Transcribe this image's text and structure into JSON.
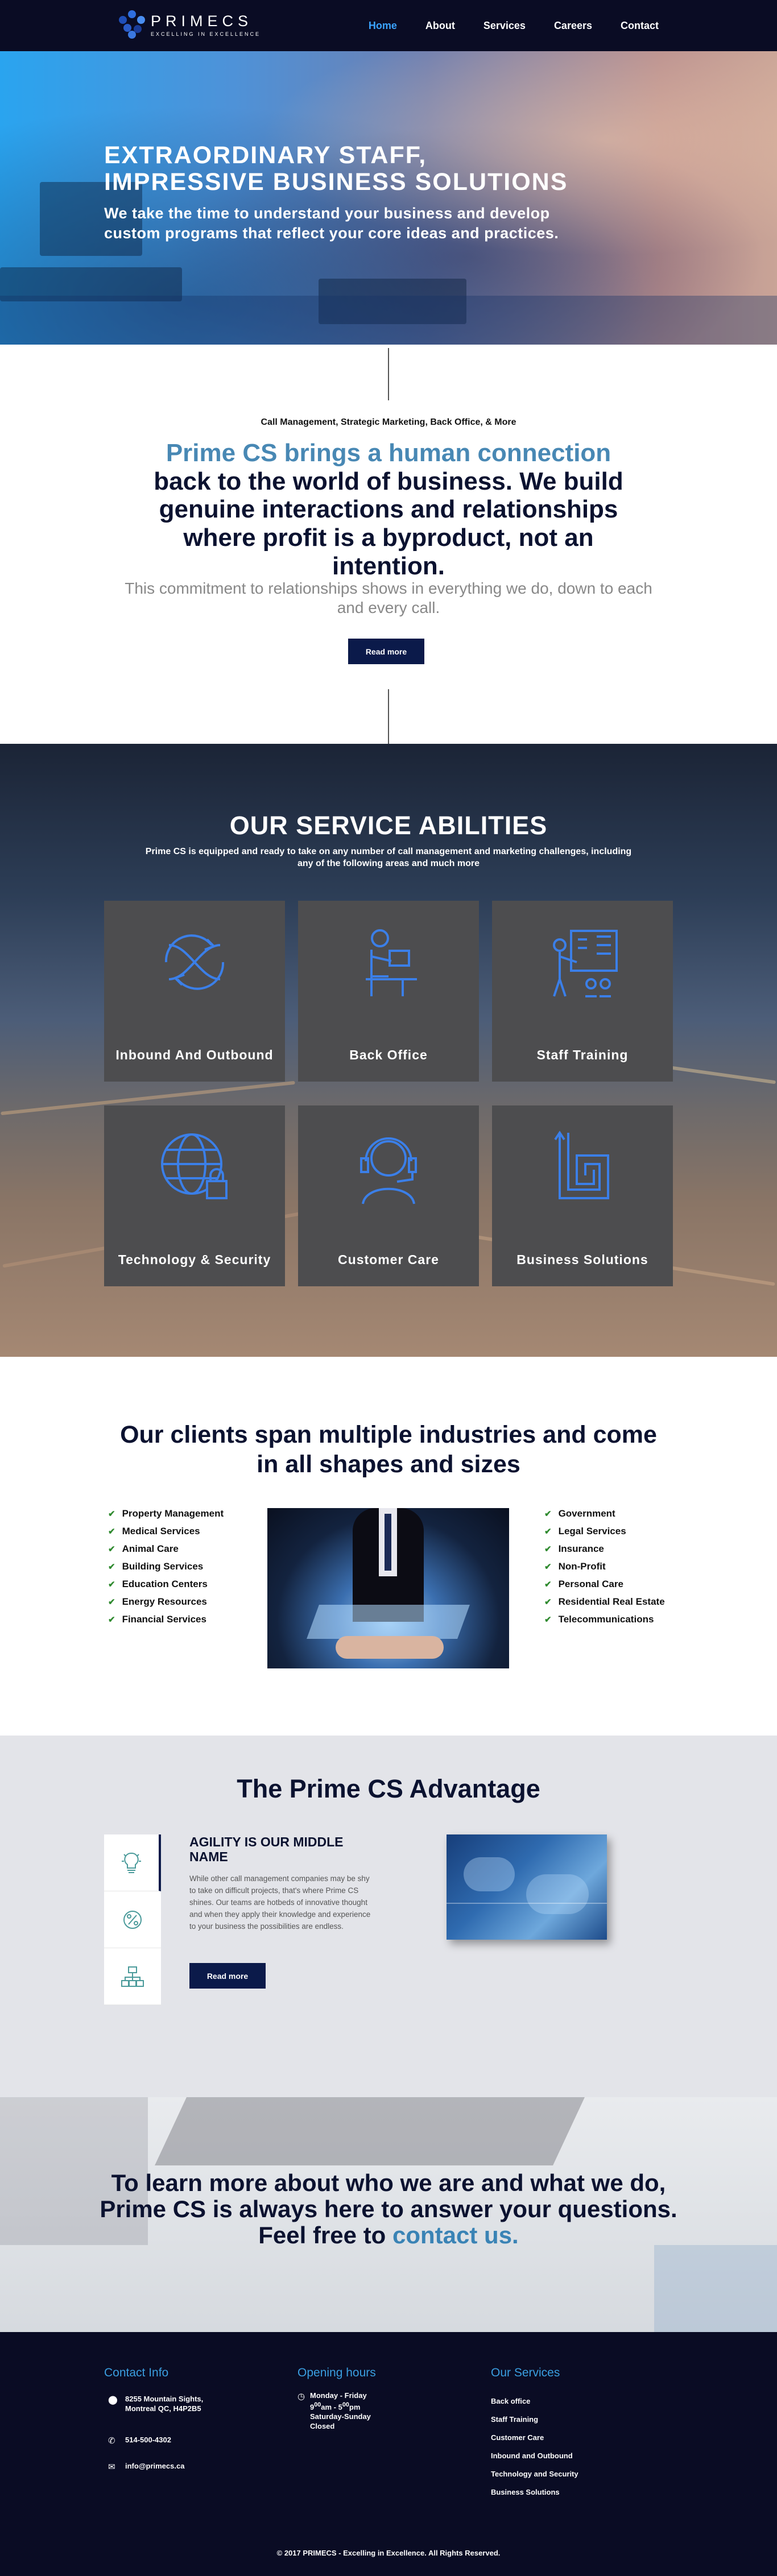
{
  "nav": {
    "logo_name": "PRIMECS",
    "logo_tagline": "EXCELLING IN EXCELLENCE",
    "links": [
      "Home",
      "About",
      "Services",
      "Careers",
      "Contact"
    ],
    "active": "Home",
    "active_color": "#3aa3ff"
  },
  "hero": {
    "title": "EXTRAORDINARY STAFF, IMPRESSIVE BUSINESS SOLUTIONS",
    "text": "We take the time to understand your business and develop custom programs that reflect your core ideas and practices."
  },
  "intro": {
    "subtitle": "Call Management, Strategic Marketing, Back Office, & More",
    "heading_highlight": "Prime CS brings a human connection",
    "heading_rest": "back to the world of business. We build genuine interactions and relationships where profit is a byproduct, not an intention.",
    "paragraph": "This commitment to relationships shows in everything we do, down to each and every call.",
    "button": "Read more"
  },
  "services": {
    "title": "OUR SERVICE ABILITIES",
    "text": "Prime CS is equipped and ready to take on any number of call management and marketing challenges, including any of the following areas and much more",
    "cards": [
      {
        "label": "Inbound And Outbound",
        "icon": "arrows-cycle-icon"
      },
      {
        "label": "Back Office",
        "icon": "desk-person-icon"
      },
      {
        "label": "Staff Training",
        "icon": "presentation-icon"
      },
      {
        "label": "Technology & Security",
        "icon": "globe-lock-icon"
      },
      {
        "label": "Customer Care",
        "icon": "headset-icon"
      },
      {
        "label": "Business Solutions",
        "icon": "maze-arrow-icon"
      }
    ],
    "icon_color": "#3b7fe8"
  },
  "clients": {
    "heading": "Our clients span multiple industries and come in all shapes and sizes",
    "left": [
      "Property Management",
      "Medical Services",
      "Animal Care",
      "Building Services",
      "Education Centers",
      "Energy Resources",
      "Financial Services"
    ],
    "right": [
      "Government",
      "Legal Services",
      "Insurance",
      "Non-Profit",
      "Personal Care",
      "Residential Real Estate",
      "Telecommunications"
    ]
  },
  "advantage": {
    "title": "The Prime CS Advantage",
    "item_title": "AGILITY IS OUR MIDDLE NAME",
    "item_text": "While other call management companies may be shy to take on difficult projects, that's where Prime CS shines. Our teams are hotbeds of innovative thought and when they apply their knowledge and experience to your business the possibilities are endless.",
    "button": "Read more",
    "tabs": [
      "lightbulb-icon",
      "percent-icon",
      "hierarchy-icon"
    ]
  },
  "cta": {
    "text": "To learn more about who we are and what we do, Prime CS is always here to answer your questions. Feel free to",
    "link": "contact us."
  },
  "footer": {
    "contact_title": "Contact Info",
    "address": "8255 Mountain Sights, Montreal QC, H4P2B5",
    "phone": "514-500-4302",
    "email": "info@primecs.ca",
    "hours_title": "Opening hours",
    "hours_days": "Monday - Friday",
    "hours_time_start": "9",
    "hours_time_start_sup": "00",
    "hours_time_start_unit": "am - 5",
    "hours_time_end_sup": "00",
    "hours_time_end_unit": "pm",
    "hours_weekend": "Saturday-Sunday",
    "hours_closed": "Closed",
    "services_title": "Our Services",
    "services": [
      "Back office",
      "Staff Training",
      "Customer Care",
      "Inbound and Outbound",
      "Technology and Security",
      "Business Solutions"
    ],
    "copyright": "© 2017 PRIMECS - Excelling in Excellence. All Rights Reserved."
  }
}
